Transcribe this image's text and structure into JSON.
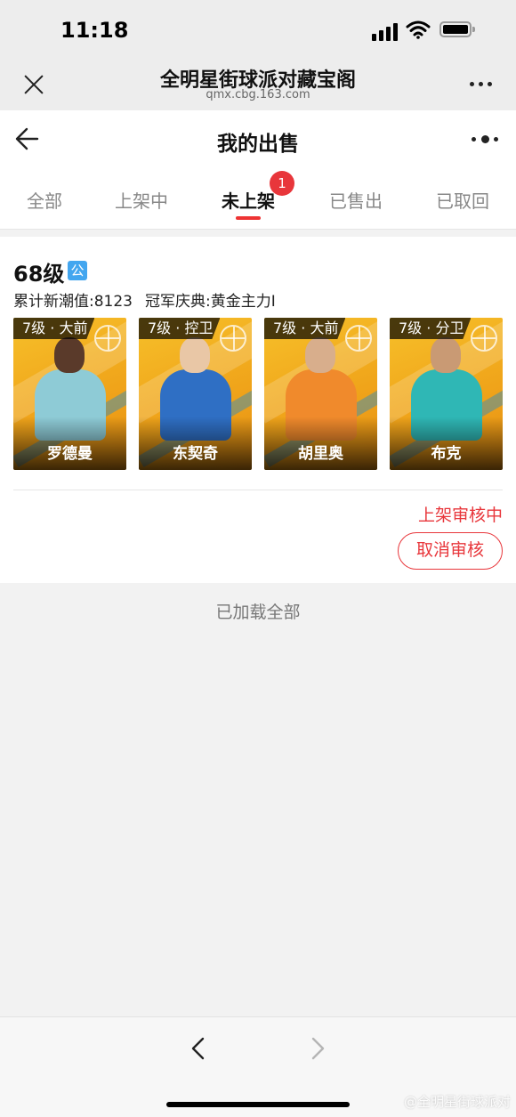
{
  "status": {
    "time": "11:18"
  },
  "browser": {
    "title": "全明星街球派对藏宝阁",
    "url": "qmx.cbg.163.com"
  },
  "header": {
    "title": "我的出售"
  },
  "tabs": [
    {
      "label": "全部"
    },
    {
      "label": "上架中"
    },
    {
      "label": "未上架",
      "badge": "1"
    },
    {
      "label": "已售出"
    },
    {
      "label": "已取回"
    }
  ],
  "listing": {
    "level": "68级",
    "public_badge": "公",
    "trend_value": "累计新潮值:8123",
    "champion": "冠军庆典:黄金主力I",
    "players": [
      {
        "rank": "7级 · 大前",
        "name": "罗德曼",
        "skin": "#5a3a2a",
        "jersey": "#8ecbd6"
      },
      {
        "rank": "7级 · 控卫",
        "name": "东契奇",
        "skin": "#e9c7a6",
        "jersey": "#2f6fc4"
      },
      {
        "rank": "7级 · 大前",
        "name": "胡里奥",
        "skin": "#d8ae8c",
        "jersey": "#f08a2c"
      },
      {
        "rank": "7级 · 分卫",
        "name": "布克",
        "skin": "#c99a74",
        "jersey": "#2fb7b5"
      }
    ],
    "status_text": "上架审核中",
    "cancel_label": "取消审核"
  },
  "footer_text": "已加载全部",
  "watermark": "@全明星街球派对",
  "colors": {
    "accent": "#e8363b",
    "public_badge": "#43a6ef"
  }
}
